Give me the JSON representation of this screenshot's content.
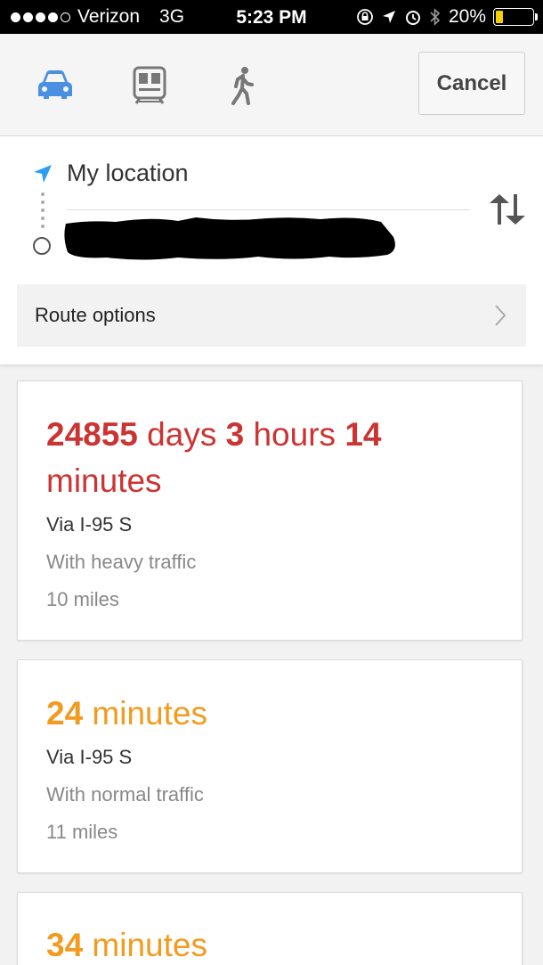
{
  "status_bar": {
    "carrier": "Verizon",
    "network": "3G",
    "time": "5:23 PM",
    "battery": "20%",
    "battery_level": 0.2,
    "signal_bars_filled": 4,
    "signal_bars_total": 5
  },
  "mode_bar": {
    "modes": [
      {
        "icon": "car-icon",
        "selected": true
      },
      {
        "icon": "transit-icon",
        "selected": false
      },
      {
        "icon": "walking-icon",
        "selected": false
      }
    ],
    "cancel_label": "Cancel"
  },
  "directions": {
    "origin": "My location",
    "destination_redacted": true,
    "route_options_label": "Route options"
  },
  "routes": [
    {
      "dur_1": "24855",
      "dur_2": " days ",
      "dur_3": "3",
      "dur_4": " hours ",
      "dur_5": "14",
      "dur_6": " minutes",
      "via": "Via I-95 S",
      "traffic": "With heavy traffic",
      "distance": "10 miles"
    },
    {
      "dur_1": "24",
      "dur_2": " minutes",
      "via": "Via I-95 S",
      "traffic": "With normal traffic",
      "distance": "11 miles"
    },
    {
      "dur_1": "34",
      "dur_2": " minutes"
    }
  ],
  "colors": {
    "heavy_traffic": "#cc3333",
    "normal_traffic": "#f29b1e",
    "selected_mode": "#4a90e2",
    "unselected_mode": "#777777"
  }
}
